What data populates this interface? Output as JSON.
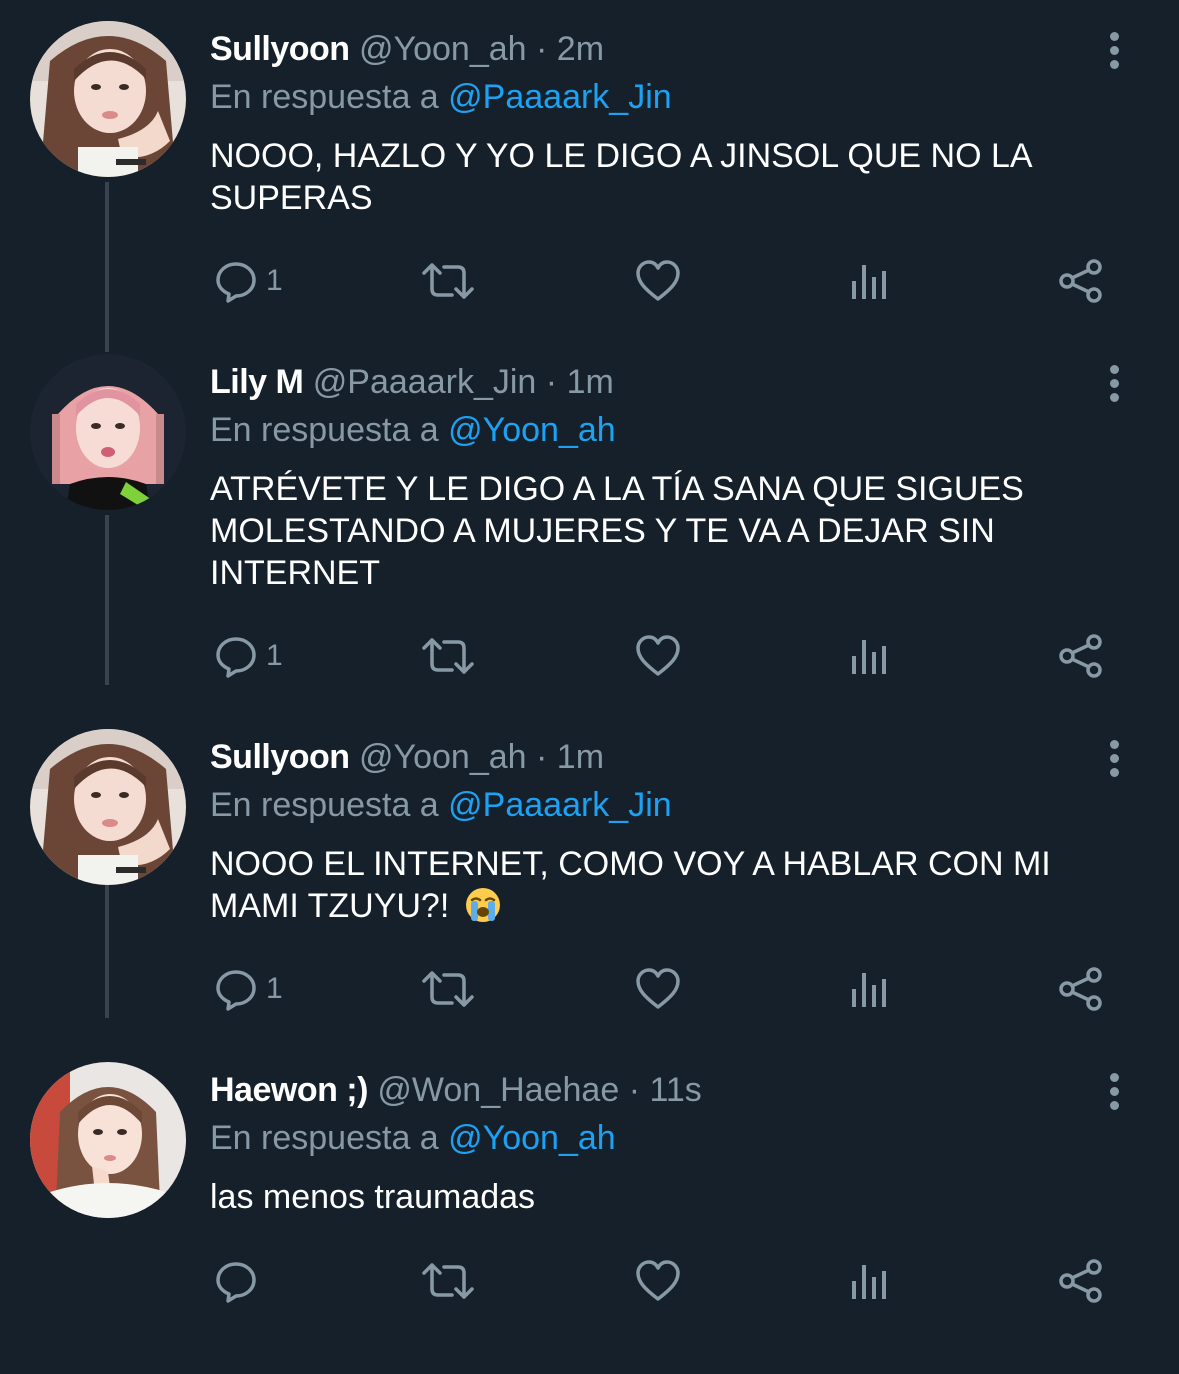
{
  "colors": {
    "background": "#15202b",
    "text_primary": "#ffffff",
    "text_secondary": "#8899a6",
    "link": "#1da1f2",
    "thread_line": "#38444d"
  },
  "tweets": [
    {
      "name": "Sullyoon",
      "handle": "@Yoon_ah",
      "separator": "·",
      "time": "2m",
      "reply_prefix": "En respuesta a",
      "reply_to": "@Paaaark_Jin",
      "text": "NOOO, HAZLO Y YO LE DIGO A JINSOL QUE NO LA SUPERAS",
      "reply_count": "1"
    },
    {
      "name": "Lily M",
      "handle": "@Paaaark_Jin",
      "separator": "·",
      "time": "1m",
      "reply_prefix": "En respuesta a",
      "reply_to": "@Yoon_ah",
      "text": "ATRÉVETE Y LE DIGO A LA TÍA SANA QUE SIGUES MOLESTANDO A MUJERES Y TE VA A DEJAR SIN INTERNET",
      "reply_count": "1"
    },
    {
      "name": "Sullyoon",
      "handle": "@Yoon_ah",
      "separator": "·",
      "time": "1m",
      "reply_prefix": "En respuesta a",
      "reply_to": "@Paaaark_Jin",
      "text": "NOOO EL INTERNET, COMO VOY A HABLAR CON MI MAMI TZUYU?!",
      "emoji": "loudly-crying-face-emoji",
      "reply_count": "1"
    },
    {
      "name": "Haewon ;)",
      "handle": "@Won_Haehae",
      "separator": "·",
      "time": "11s",
      "reply_prefix": "En respuesta a",
      "reply_to": "@Yoon_ah",
      "text": "las menos traumadas",
      "reply_count": ""
    }
  ],
  "icons": {
    "reply": "reply-icon",
    "retweet": "retweet-icon",
    "like": "heart-icon",
    "analytics": "analytics-icon",
    "share": "share-icon",
    "more": "more-vertical-icon"
  }
}
